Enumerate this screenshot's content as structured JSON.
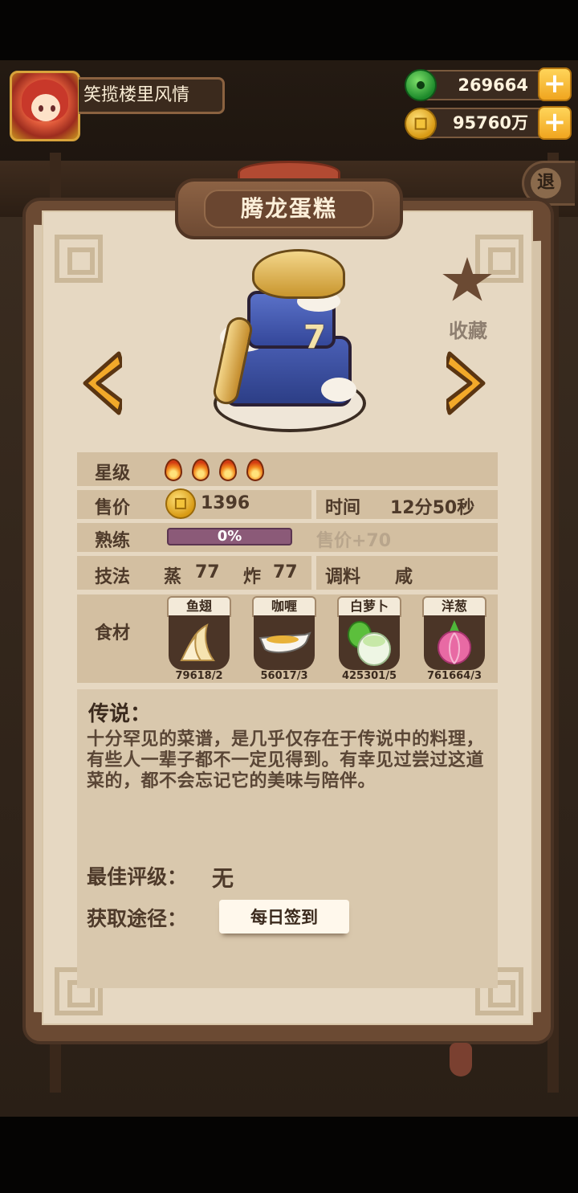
{
  "player": {
    "name": "笑揽楼里风情"
  },
  "resources": {
    "jade": "269664",
    "gold": "95760万"
  },
  "header": {
    "exit_label": "退"
  },
  "dish": {
    "title": "腾龙蛋糕",
    "favorite_label": "收藏",
    "cake_number": "7"
  },
  "stats": {
    "star_label": "星级",
    "star_count": 4,
    "price_label": "售价",
    "price_value": "1396",
    "time_label": "时间",
    "time_value": "12分50秒",
    "mastery_label": "熟练",
    "mastery_progress": 0,
    "mastery_text": "0%",
    "mastery_bonus": "售价+70",
    "skill_label": "技法",
    "skill1_name": "蒸",
    "skill1_value": "77",
    "skill2_name": "炸",
    "skill2_value": "77",
    "seasoning_label": "调料",
    "seasoning_value": "咸"
  },
  "ingredients": {
    "label": "食材",
    "items": [
      {
        "name": "鱼翅",
        "amount": "79618/2"
      },
      {
        "name": "咖喱",
        "amount": "56017/3"
      },
      {
        "name": "白萝卜",
        "amount": "425301/5"
      },
      {
        "name": "洋葱",
        "amount": "761664/3"
      }
    ]
  },
  "legend": {
    "title": "传说：",
    "text": "十分罕见的菜谱，是几乎仅存在于传说中的料理，有些人一辈子都不一定见得到。有幸见过尝过这道菜的，都不会忘记它的美味与陪伴。"
  },
  "rating": {
    "label": "最佳评级：",
    "value": "无"
  },
  "source": {
    "label": "获取途径：",
    "button": "每日签到"
  }
}
